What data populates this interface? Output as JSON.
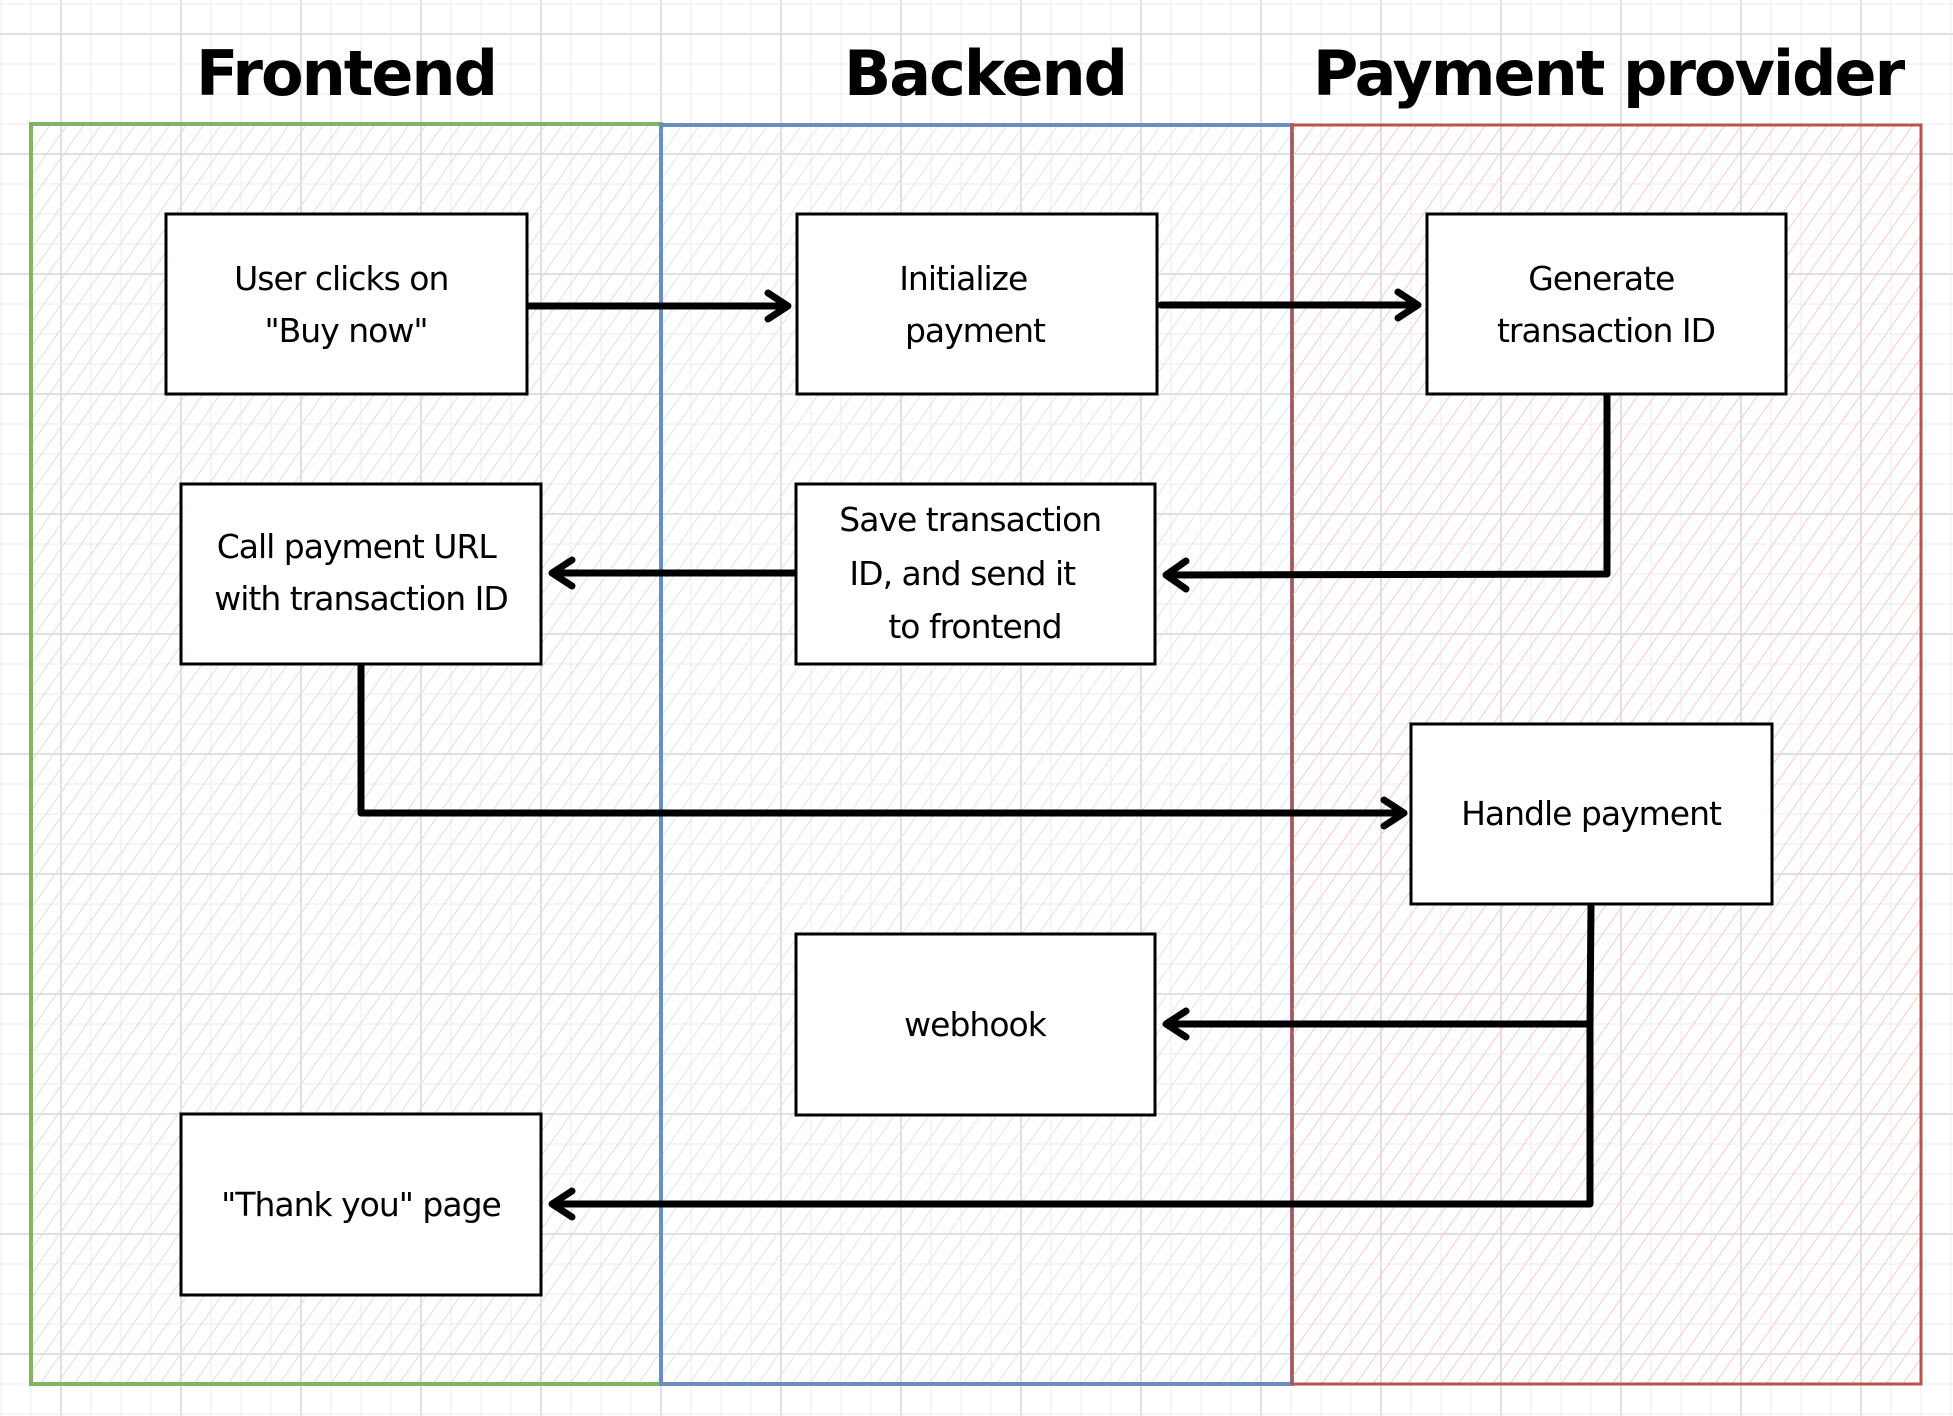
{
  "diagram": {
    "type": "swimlane-flowchart",
    "lanes": [
      {
        "id": "frontend",
        "title": "Frontend",
        "stroke": "#82b366",
        "fill": "#d5e8d4"
      },
      {
        "id": "backend",
        "title": "Backend",
        "stroke": "#6c8ebf",
        "fill": "#dae8fc"
      },
      {
        "id": "provider",
        "title": "Payment provider",
        "stroke": "#b85450",
        "fill": "#f8cecc"
      }
    ],
    "nodes": [
      {
        "id": "buy",
        "lane": "frontend",
        "lines": [
          "User clicks on",
          "\"Buy now\""
        ]
      },
      {
        "id": "init",
        "lane": "backend",
        "lines": [
          "Initialize",
          "payment"
        ]
      },
      {
        "id": "gen",
        "lane": "provider",
        "lines": [
          "Generate",
          "transaction ID"
        ]
      },
      {
        "id": "call",
        "lane": "frontend",
        "lines": [
          "Call payment URL",
          "with transaction ID"
        ]
      },
      {
        "id": "save",
        "lane": "backend",
        "lines": [
          "Save transaction",
          "ID, and send it",
          "to frontend"
        ]
      },
      {
        "id": "handle",
        "lane": "provider",
        "lines": [
          "Handle payment"
        ]
      },
      {
        "id": "webhook",
        "lane": "backend",
        "lines": [
          "webhook"
        ]
      },
      {
        "id": "thanks",
        "lane": "frontend",
        "lines": [
          "\"Thank you\" page"
        ]
      }
    ],
    "edges": [
      {
        "from": "buy",
        "to": "init"
      },
      {
        "from": "init",
        "to": "gen"
      },
      {
        "from": "gen",
        "to": "save"
      },
      {
        "from": "save",
        "to": "call"
      },
      {
        "from": "call",
        "to": "handle"
      },
      {
        "from": "handle",
        "to": "webhook"
      },
      {
        "from": "handle",
        "to": "thanks"
      }
    ],
    "colors": {
      "grid_major": "#d6d6d6",
      "grid_minor": "#efefef",
      "ink": "#000000"
    }
  }
}
